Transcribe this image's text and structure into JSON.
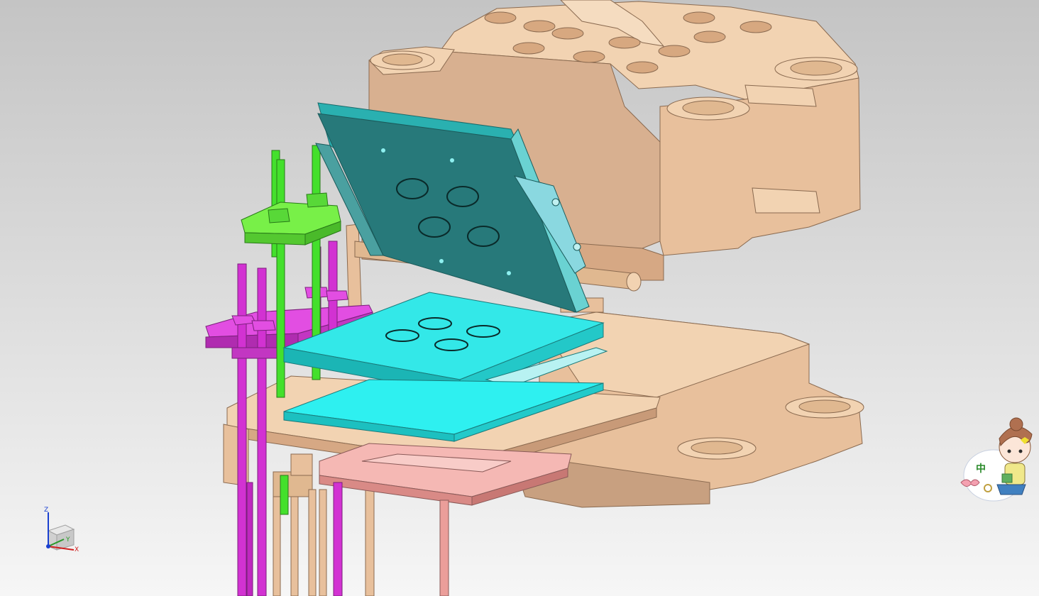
{
  "viewport": {
    "background_top": "#c4c4c4",
    "background_bottom": "#f6f6f6"
  },
  "parts": {
    "mold_base_color": "#e8c4a0",
    "cavity_plate_color": "#24797a",
    "core_plate_color": "#2ae6e6",
    "lifter_plate_color": "#6af034",
    "ejector_plate_color": "#d432d4",
    "ejector_retainer_color": "#f0a4a0"
  },
  "triad": {
    "z_label": "Z",
    "y_label": "Y",
    "x_label": "X"
  },
  "ime": {
    "mode_char": "中"
  }
}
